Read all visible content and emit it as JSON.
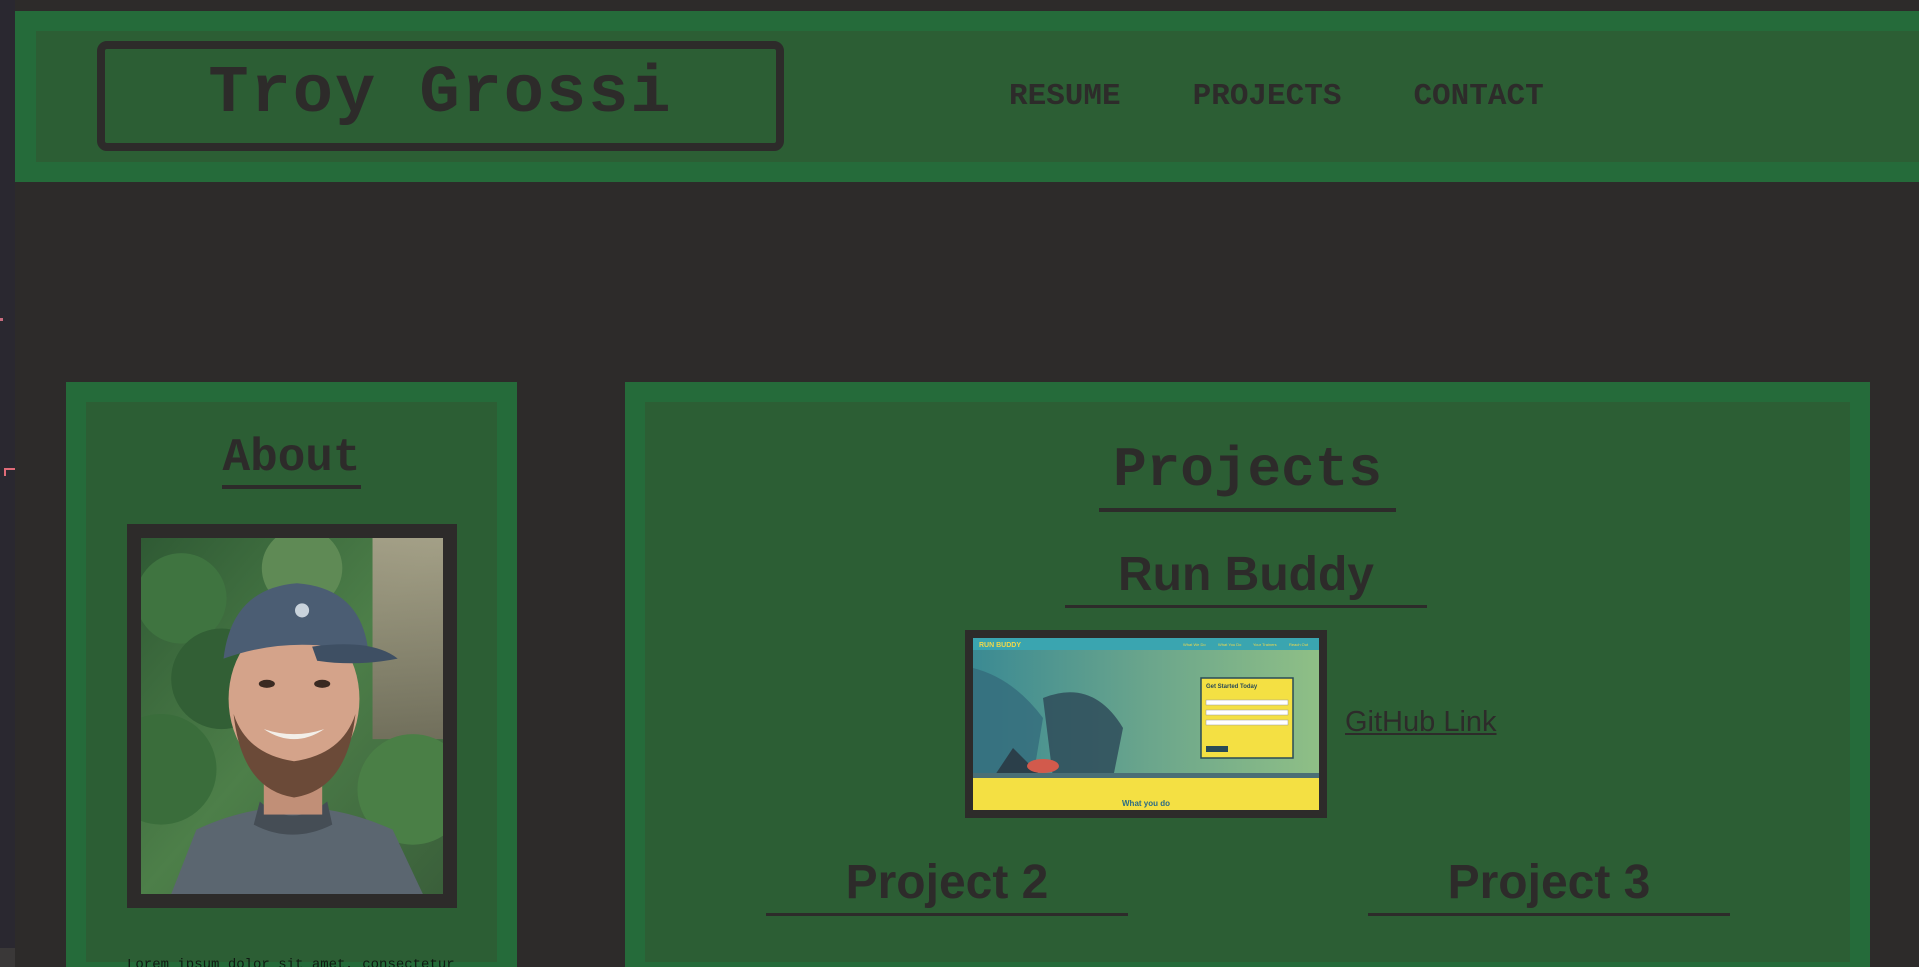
{
  "header": {
    "logo_text": "Troy Grossi",
    "nav": [
      "RESUME",
      "PROJECTS",
      "CONTACT"
    ]
  },
  "about": {
    "title": "About",
    "body": "Lorem ipsum dolor sit amet, consectetur adipiscing elit,"
  },
  "projects": {
    "title": "Projects",
    "items": [
      {
        "name": "Run Buddy",
        "link_text": "GitHub Link",
        "screenshot": {
          "brand": "RUN BUDDY",
          "nav": [
            "What We Do",
            "What You Do",
            "Your Trainers",
            "Reach Out"
          ],
          "form_title": "Get Started Today",
          "footer_title": "What you do"
        }
      },
      {
        "name": "Project 2"
      },
      {
        "name": "Project 3"
      }
    ]
  },
  "colors": {
    "background": "#2d2b2a",
    "card_border": "#256b3a",
    "card_fill": "#2c5e34",
    "text_dark": "#2d2b2a"
  }
}
